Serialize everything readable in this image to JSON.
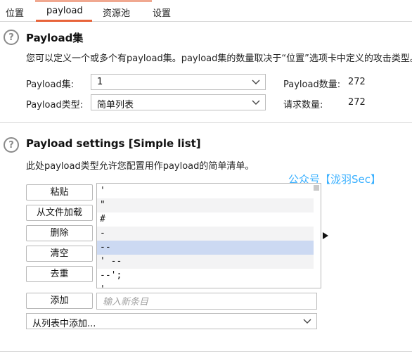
{
  "tabs": [
    {
      "label": "位置"
    },
    {
      "label": "payload"
    },
    {
      "label": "资源池"
    },
    {
      "label": "设置"
    }
  ],
  "payload_sets": {
    "title": "Payload集",
    "description": "您可以定义一个或多个有payload集。payload集的数量取决于“位置”选项卡中定义的攻击类型。",
    "set_label": "Payload集:",
    "set_value": "1",
    "type_label": "Payload类型:",
    "type_value": "简单列表",
    "count_label": "Payload数量:",
    "count_value": "272",
    "request_label": "请求数量:",
    "request_value": "272"
  },
  "payload_settings": {
    "title": "Payload settings [Simple list]",
    "description": "此处payload类型允许您配置用作payload的简单清单。",
    "buttons": {
      "paste": "粘贴",
      "load": "从文件加载",
      "remove": "删除",
      "clear": "清空",
      "dedupe": "去重",
      "add": "添加"
    },
    "list_items": [
      "'",
      "\"",
      "#",
      "-",
      "--",
      "' --",
      "--';",
      "'"
    ],
    "selected_index": 4,
    "add_placeholder": "输入新条目",
    "add_from_list": "从列表中添加..."
  },
  "watermark": "公众号【泷羽Sec】",
  "colors": {
    "accent": "#e8643a",
    "selection": "#ccd9f2",
    "watermark": "#3ab0ff"
  },
  "icons": {
    "help": "help-icon",
    "dropdown": "chevron-down-icon",
    "expand": "arrow-right-icon"
  }
}
